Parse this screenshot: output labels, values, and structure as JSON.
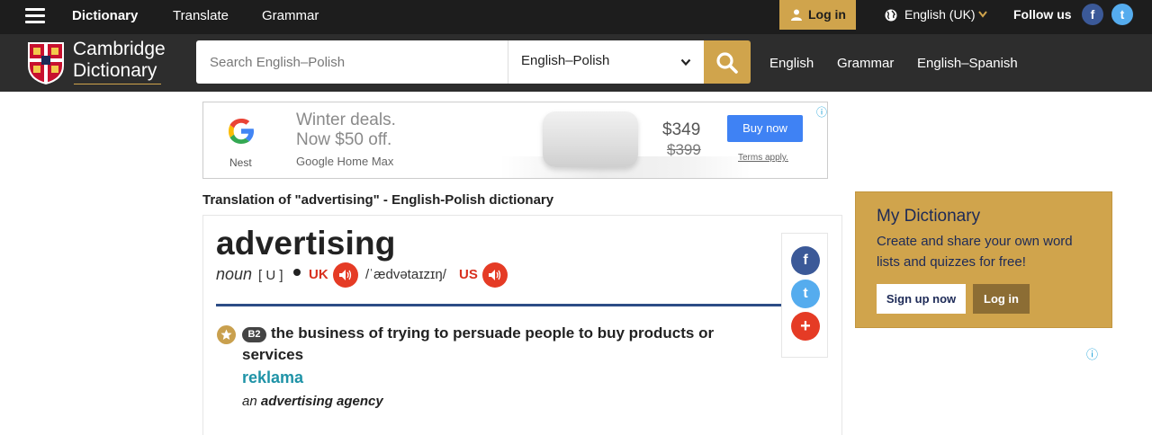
{
  "topbar": {
    "menu_icon": "hamburger-icon",
    "nav": [
      "Dictionary",
      "Translate",
      "Grammar"
    ],
    "login_label": "Log in",
    "language_label": "English (UK)",
    "follow_label": "Follow us",
    "social": [
      "facebook-icon",
      "twitter-icon"
    ],
    "social_glyphs": [
      "f",
      "t"
    ]
  },
  "header": {
    "logo_line1": "Cambridge",
    "logo_line2": "Dictionary",
    "search_placeholder": "Search English–Polish",
    "dictionary_select": "English–Polish",
    "nav": [
      "English",
      "Grammar",
      "English–Spanish"
    ]
  },
  "ad": {
    "brand_caption": "Nest",
    "headline_line1": "Winter deals.",
    "headline_line2": "Now $50 off.",
    "product": "Google Home Max",
    "price": "$349",
    "old_price": "$399",
    "cta": "Buy now",
    "terms": "Terms apply.",
    "info_glyph": "ⓘ"
  },
  "page": {
    "translation_title": "Translation of \"advertising\" - English-Polish dictionary"
  },
  "entry": {
    "headword": "advertising",
    "pos": "noun",
    "grammar": "[ U ]",
    "uk_label": "UK",
    "us_label": "US",
    "ipa": "/ˈædvətaɪzɪŋ/",
    "level": "B2",
    "definition": "the business of trying to persuade people to buy products or services",
    "translation": "reklama",
    "example_prefix": "an",
    "example_bold": "advertising agency",
    "share_glyphs": [
      "f",
      "t",
      "+"
    ]
  },
  "sidebar": {
    "title": "My Dictionary",
    "description": "Create and share your own word lists and quizzes for free!",
    "signup_label": "Sign up now",
    "login_label": "Log in",
    "info_glyph": "ⓘ"
  },
  "colors": {
    "accent_gold": "#d0a44c",
    "dark_bar": "#1d1d1d",
    "header_bg": "#2d2d2d",
    "audio_red": "#e53b25",
    "translation_teal": "#1f93a7",
    "divider_blue": "#2c4c86",
    "facebook": "#3b5998",
    "twitter": "#55acee",
    "share_plus": "#e53b25"
  }
}
